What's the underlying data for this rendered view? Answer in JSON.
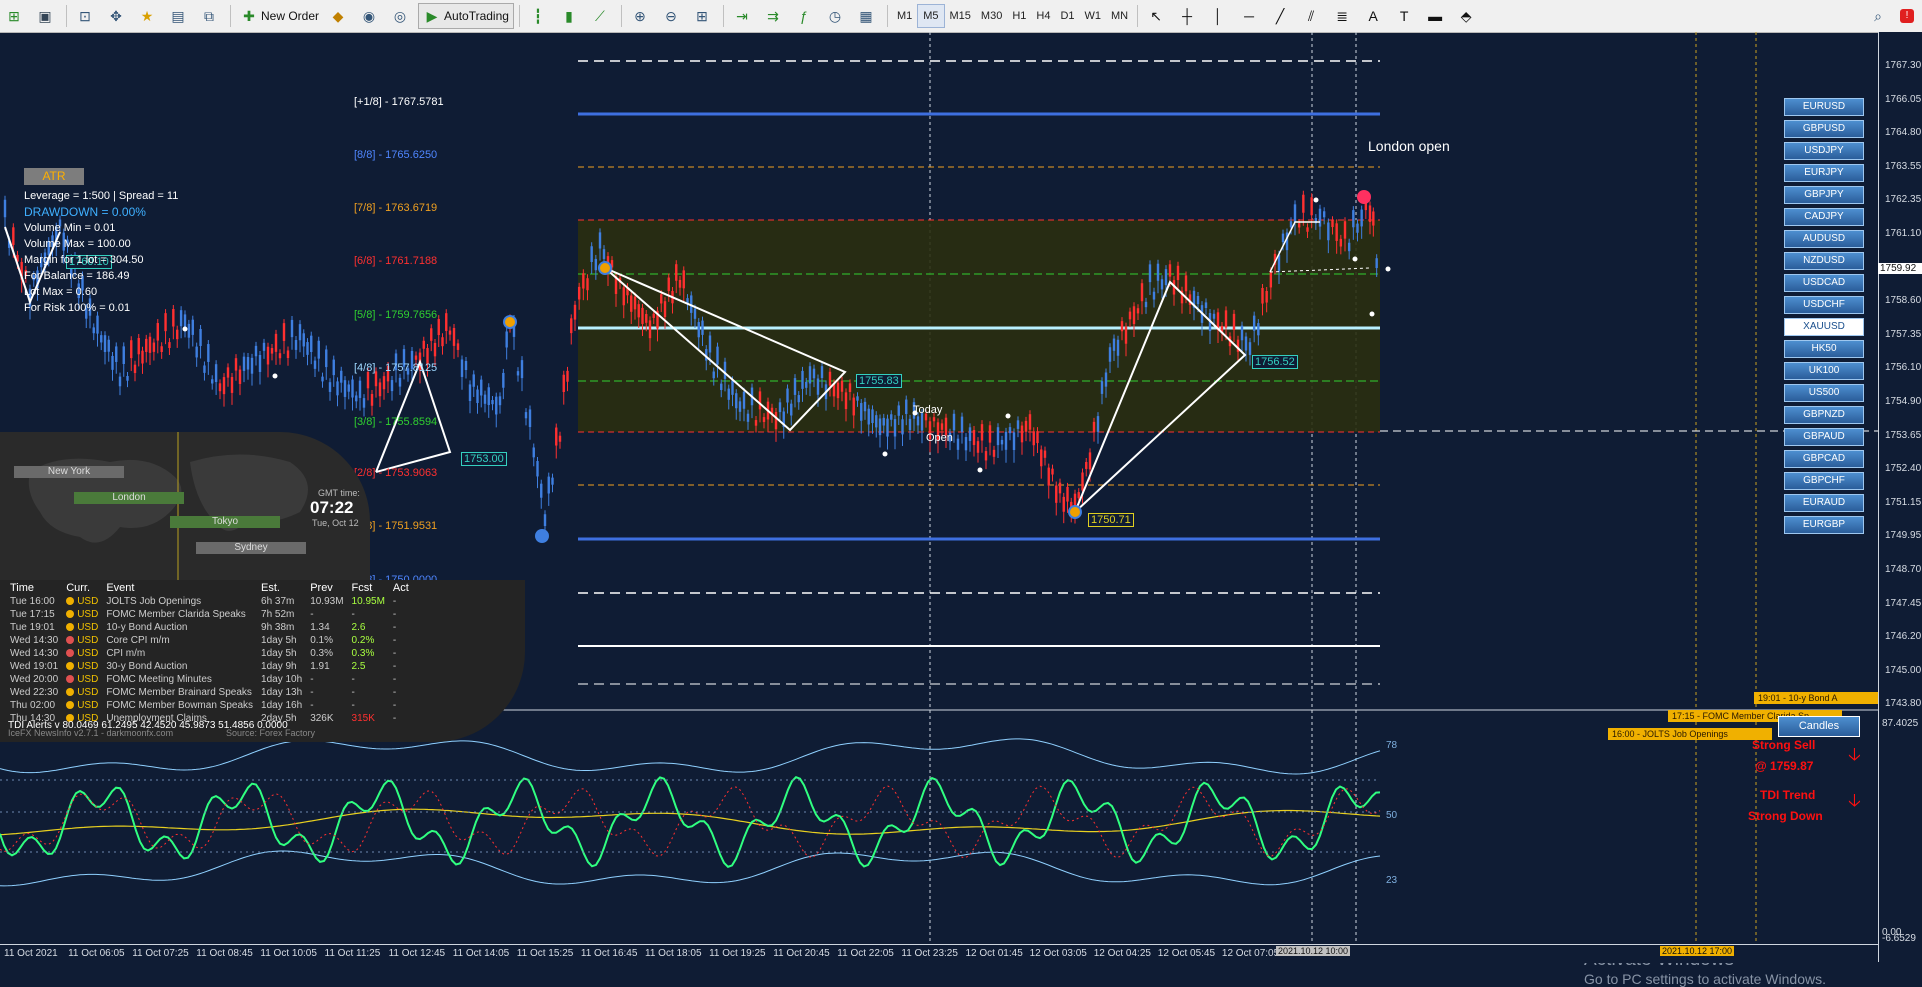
{
  "toolbar": {
    "new_order": "New Order",
    "autotrading": "AutoTrading",
    "timeframes": [
      "M1",
      "M5",
      "M15",
      "M30",
      "H1",
      "H4",
      "D1",
      "W1",
      "MN"
    ],
    "active_timeframe": "M5"
  },
  "murrey_levels": [
    {
      "label": "[+1/8] - 1767.5781",
      "color": "#ffffff"
    },
    {
      "label": "[8/8] - 1765.6250",
      "color": "#4f86ff"
    },
    {
      "label": "[7/8] - 1763.6719",
      "color": "#f0a020"
    },
    {
      "label": "[6/8] - 1761.7188",
      "color": "#ff3030"
    },
    {
      "label": "[5/8] - 1759.7656",
      "color": "#30d030"
    },
    {
      "label": "[4/8] - 1757.8125",
      "color": "#9ed8ff"
    },
    {
      "label": "[3/8] - 1755.8594",
      "color": "#30d030"
    },
    {
      "label": "[2/8] - 1753.9063",
      "color": "#ff3030"
    },
    {
      "label": "[1/8] - 1751.9531",
      "color": "#f0a020"
    },
    {
      "label": "[0/8] - 1750.0000",
      "color": "#4f86ff"
    }
  ],
  "atr": {
    "title": "ATR",
    "leverage": "Leverage = 1:500 | Spread = 11",
    "drawdown": "DRAWDOWN =  0.00%",
    "volume_min": "Volume Min = 0.01",
    "volume_max": "Volume Max = 100.00",
    "margin": "Margin for 1 lot = 304.50",
    "balance": "For Balance = 186.49",
    "lot_max": "Lot Max = 0.60",
    "risk": "For Risk 100% = 0.01"
  },
  "world": {
    "sessions": [
      "New York",
      "London",
      "Tokyo",
      "Sydney"
    ],
    "gmt_label": "GMT time:",
    "time": "07:22",
    "date": "Tue, Oct 12"
  },
  "news": {
    "headers": [
      "Time",
      "Curr.",
      "Event",
      "Est.",
      "Prev",
      "Fcst",
      "Act"
    ],
    "rows": [
      [
        "Tue 16:00",
        "USD",
        "JOLTS Job Openings",
        "6h 37m",
        "10.93M",
        "10.95M",
        "-",
        "#f0b000"
      ],
      [
        "Tue 17:15",
        "USD",
        "FOMC Member Clarida Speaks",
        "7h 52m",
        "-",
        "-",
        "-",
        "#f0b000"
      ],
      [
        "Tue 19:01",
        "USD",
        "10-y Bond Auction",
        "9h 38m",
        "1.34",
        "2.6",
        "-",
        "#f0b000"
      ],
      [
        "Wed 14:30",
        "USD",
        "Core CPI m/m",
        "1day 5h",
        "0.1%",
        "0.2%",
        "-",
        "#e05050"
      ],
      [
        "Wed 14:30",
        "USD",
        "CPI m/m",
        "1day 5h",
        "0.3%",
        "0.3%",
        "-",
        "#e05050"
      ],
      [
        "Wed 19:01",
        "USD",
        "30-y Bond Auction",
        "1day 9h",
        "1.91",
        "2.5",
        "-",
        "#f0b000"
      ],
      [
        "Wed 20:00",
        "USD",
        "FOMC Meeting Minutes",
        "1day 10h",
        "-",
        "-",
        "-",
        "#e05050"
      ],
      [
        "Wed 22:30",
        "USD",
        "FOMC Member Brainard Speaks",
        "1day 13h",
        "-",
        "-",
        "-",
        "#f0b000"
      ],
      [
        "Thu 02:00",
        "USD",
        "FOMC Member Bowman Speaks",
        "1day 16h",
        "-",
        "-",
        "-",
        "#f0b000"
      ],
      [
        "Thu 14:30",
        "USD",
        "Unemployment Claims",
        "2day 5h",
        "326K",
        "315K",
        "-",
        "#f0b000"
      ]
    ],
    "footer_left": "IceFX NewsInfo v2.7.1  -  darkmoonfx.com",
    "footer_right": "Source: Forex Factory"
  },
  "chart_labels": {
    "london_open": "London open",
    "today": "Today",
    "open": "Open",
    "price_tag_1": "1755.83",
    "price_tag_2": "1756.52",
    "price_tag_3": "1750.71",
    "price_tag_4": "1753.00",
    "price_tag_5": "1760.10",
    "current_price": "1759.92"
  },
  "symbols": [
    "EURUSD",
    "GBPUSD",
    "USDJPY",
    "EURJPY",
    "GBPJPY",
    "CADJPY",
    "AUDUSD",
    "NZDUSD",
    "USDCAD",
    "USDCHF",
    "XAUUSD",
    "HK50",
    "UK100",
    "US500",
    "GBPNZD",
    "GBPAUD",
    "GBPCAD",
    "GBPCHF",
    "EURAUD",
    "EURGBP"
  ],
  "selected_symbol": "XAUUSD",
  "price_axis": [
    "1767.30",
    "1766.05",
    "1764.80",
    "1763.55",
    "1762.35",
    "1761.10",
    "1759.92",
    "1758.60",
    "1757.35",
    "1756.10",
    "1754.90",
    "1753.65",
    "1752.40",
    "1751.15",
    "1749.95",
    "1748.70",
    "1747.45",
    "1746.20",
    "1745.00",
    "1743.80"
  ],
  "events_bar": [
    {
      "text": "19:01 - 10-y Bond A"
    },
    {
      "text": "17:15 - FOMC Member Clarida Sp"
    },
    {
      "text": "16:00 - JOLTS Job Openings"
    }
  ],
  "candles_button": "Candles",
  "tdi": {
    "title": "TDI Alerts v 80.0469 61.2495 42.4520 45.9873 51.4856 0.0000",
    "levels": [
      "78",
      "50",
      "23"
    ],
    "axis_top": "87.4025",
    "axis_bottom": "0.00",
    "axis_bottom2": "-6.6529",
    "signal1": "Strong Sell",
    "signal2": "@ 1759.87",
    "signal3": "TDI Trend",
    "signal4": "Strong Down"
  },
  "time_axis": [
    "11 Oct 2021",
    "11 Oct 06:05",
    "11 Oct 07:25",
    "11 Oct 08:45",
    "11 Oct 10:05",
    "11 Oct 11:25",
    "11 Oct 12:45",
    "11 Oct 14:05",
    "11 Oct 15:25",
    "11 Oct 16:45",
    "11 Oct 18:05",
    "11 Oct 19:25",
    "11 Oct 20:45",
    "11 Oct 22:05",
    "11 Oct 23:25",
    "12 Oct 01:45",
    "12 Oct 03:05",
    "12 Oct 04:25",
    "12 Oct 05:45",
    "12 Oct 07:05"
  ],
  "time_badges": [
    "2021.10.12 10:00",
    "2021.10.12 17:00"
  ],
  "activate": {
    "line1": "Activate Windows",
    "line2": "Go to PC settings to activate Windows."
  }
}
